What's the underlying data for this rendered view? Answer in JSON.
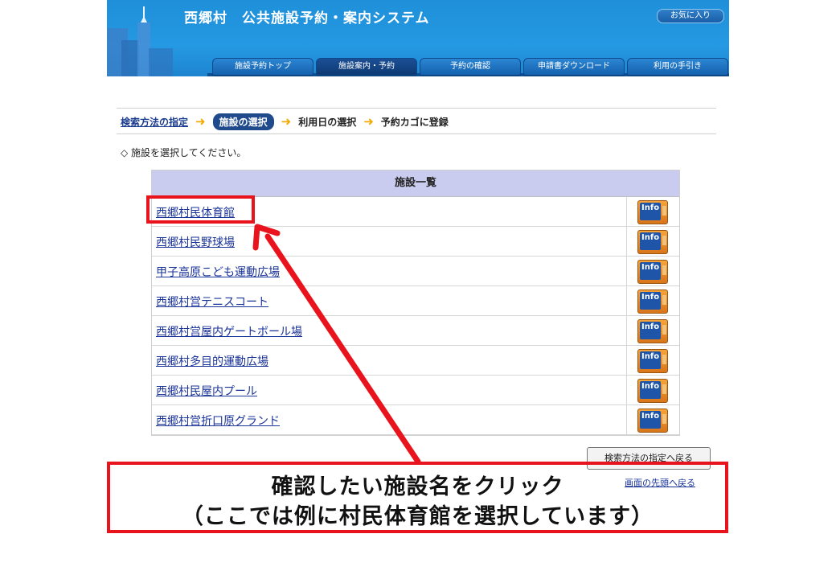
{
  "header": {
    "title": "西郷村　公共施設予約・案内システム",
    "favorites_label": "お気に入り",
    "nav_tabs": [
      {
        "label": "施設予約トップ"
      },
      {
        "label": "施設案内・予約"
      },
      {
        "label": "予約の確認"
      },
      {
        "label": "申請書ダウンロード"
      },
      {
        "label": "利用の手引き"
      }
    ]
  },
  "breadcrumb": {
    "step1": "検索方法の指定",
    "step2": "施設の選択",
    "step3": "利用日の選択",
    "step4": "予約カゴに登録"
  },
  "instruction": "◇ 施設を選択してください。",
  "facility_table": {
    "header": "施設一覧",
    "info_label": "Info",
    "rows": [
      {
        "name": "西郷村民体育館"
      },
      {
        "name": "西郷村民野球場"
      },
      {
        "name": "甲子高原こども運動広場"
      },
      {
        "name": "西郷村営テニスコート"
      },
      {
        "name": "西郷村営屋内ゲートボール場"
      },
      {
        "name": "西郷村多目的運動広場"
      },
      {
        "name": "西郷村民屋内プール"
      },
      {
        "name": "西郷村営折口原グランド"
      }
    ]
  },
  "footer": {
    "back_button": "検索方法の指定へ戻る",
    "top_link": "画面の先頭へ戻る"
  },
  "annotation": {
    "line1": "確認したい施設名をクリック",
    "line2": "（ここでは例に村民体育館を選択しています）",
    "color": "#e8131c"
  },
  "colors": {
    "banner": "#2599e3",
    "nav_tab": "#1561ae",
    "link": "#1a3399",
    "table_header": "#c9ccee",
    "step_arrow": "#f2a900"
  }
}
